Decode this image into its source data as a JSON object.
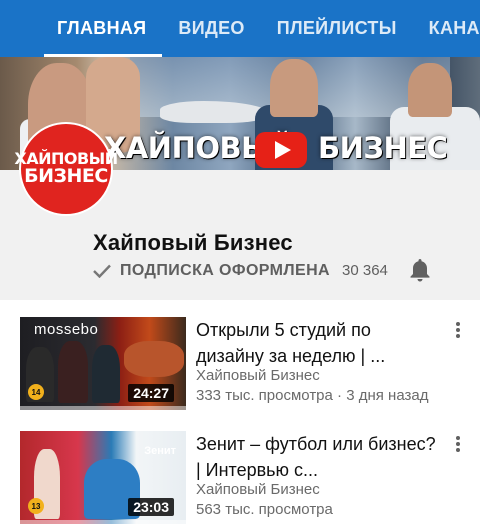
{
  "tabs": [
    {
      "label": "ГЛАВНАЯ",
      "active": true
    },
    {
      "label": "ВИДЕО",
      "active": false
    },
    {
      "label": "ПЛЕЙЛИСТЫ",
      "active": false
    },
    {
      "label": "КАНАЛЫ",
      "active": false
    }
  ],
  "banner": {
    "word_left": "ХАЙПОВЫЙ",
    "word_right": "БИЗНЕС",
    "logo_icon": "youtube-play-icon"
  },
  "avatar": {
    "line1": "ХАЙПОВЫЙ",
    "line2": "БИЗНЕС"
  },
  "channel": {
    "name": "Хайповый Бизнес",
    "subscribe_label": "ПОДПИСКА ОФОРМЛЕНА",
    "subscriber_count": "30 364",
    "check_icon": "check-icon",
    "bell_icon": "bell-icon"
  },
  "videos": [
    {
      "title": "Открыли 5 студий по дизайну за неделю | ...",
      "channel": "Хайповый Бизнес",
      "meta": "333 тыс. просмотра · 3 дня назад",
      "duration": "24:27",
      "episode": "14",
      "thumb_brand": "mossebo",
      "thumb_brand2": ""
    },
    {
      "title": "Зенит – футбол или бизнес? | Интервью с...",
      "channel": "Хайповый Бизнес",
      "meta": "563 тыс. просмотра",
      "duration": "23:03",
      "episode": "13",
      "thumb_brand": "",
      "thumb_brand2": "Зенит"
    }
  ],
  "colors": {
    "tabbar": "#1a73c7",
    "header_bg": "#f1f1f1",
    "avatar_red": "#e0241f",
    "youtube_red": "#e62117"
  }
}
